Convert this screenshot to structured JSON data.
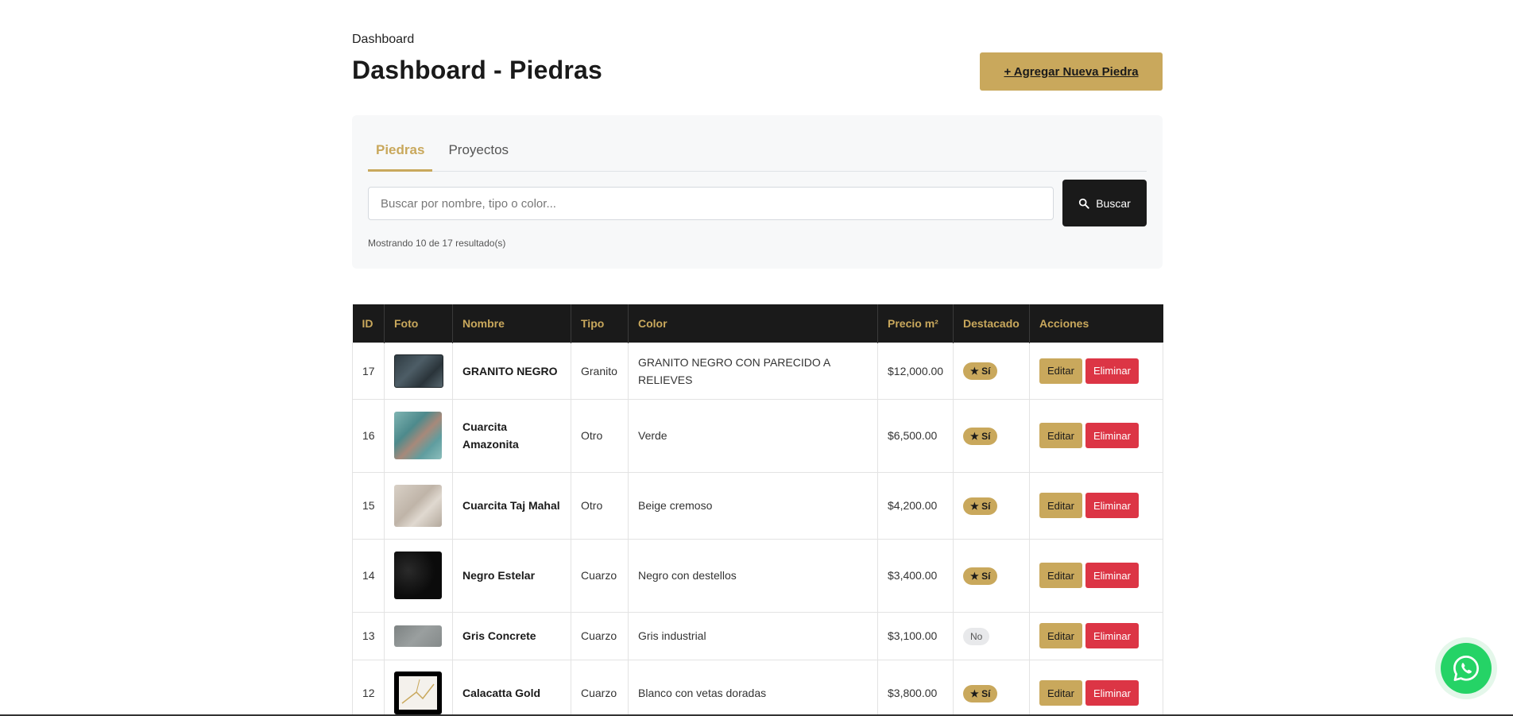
{
  "header": {
    "breadcrumb": "Dashboard",
    "title": "Dashboard - Piedras",
    "add_button_label": "+ Agregar Nueva Piedra"
  },
  "tabs": [
    {
      "label": "Piedras",
      "active": true
    },
    {
      "label": "Proyectos",
      "active": false
    }
  ],
  "search": {
    "placeholder": "Buscar por nombre, tipo o color...",
    "value": "",
    "button_label": "Buscar",
    "results_text": "Mostrando 10 de 17 resultado(s)"
  },
  "table": {
    "headers": [
      "ID",
      "Foto",
      "Nombre",
      "Tipo",
      "Color",
      "Precio m²",
      "Destacado",
      "Acciones"
    ],
    "edit_label": "Editar",
    "delete_label": "Eliminar",
    "rows": [
      {
        "id": "17",
        "nombre": "GRANITO NEGRO",
        "tipo": "Granito",
        "color": "GRANITO NEGRO CON PARECIDO A RELIEVES",
        "precio": "$12,000.00",
        "destacado": "★ Sí",
        "featured": true,
        "swatch": "#3c4a52"
      },
      {
        "id": "16",
        "nombre": "Cuarcita Amazonita",
        "tipo": "Otro",
        "color": "Verde",
        "precio": "$6,500.00",
        "destacado": "★ Sí",
        "featured": true,
        "swatch": "#5f9a9a"
      },
      {
        "id": "15",
        "nombre": "Cuarcita Taj Mahal",
        "tipo": "Otro",
        "color": "Beige cremoso",
        "precio": "$4,200.00",
        "destacado": "★ Sí",
        "featured": true,
        "swatch": "#cfc4b8"
      },
      {
        "id": "14",
        "nombre": "Negro Estelar",
        "tipo": "Cuarzo",
        "color": "Negro con destellos",
        "precio": "$3,400.00",
        "destacado": "★ Sí",
        "featured": true,
        "swatch": "#111111"
      },
      {
        "id": "13",
        "nombre": "Gris Concrete",
        "tipo": "Cuarzo",
        "color": "Gris industrial",
        "precio": "$3,100.00",
        "destacado": "No",
        "featured": false,
        "swatch": "#8e9292"
      },
      {
        "id": "12",
        "nombre": "Calacatta Gold",
        "tipo": "Cuarzo",
        "color": "Blanco con vetas doradas",
        "precio": "$3,800.00",
        "destacado": "★ Sí",
        "featured": true,
        "swatch": "#f4f1ec"
      }
    ]
  },
  "colors": {
    "accent": "#c9a85c",
    "dark": "#1a1a1a",
    "danger": "#dc3545",
    "whatsapp": "#25d366"
  },
  "icons": {
    "search": "search-icon",
    "whatsapp": "whatsapp-icon"
  }
}
